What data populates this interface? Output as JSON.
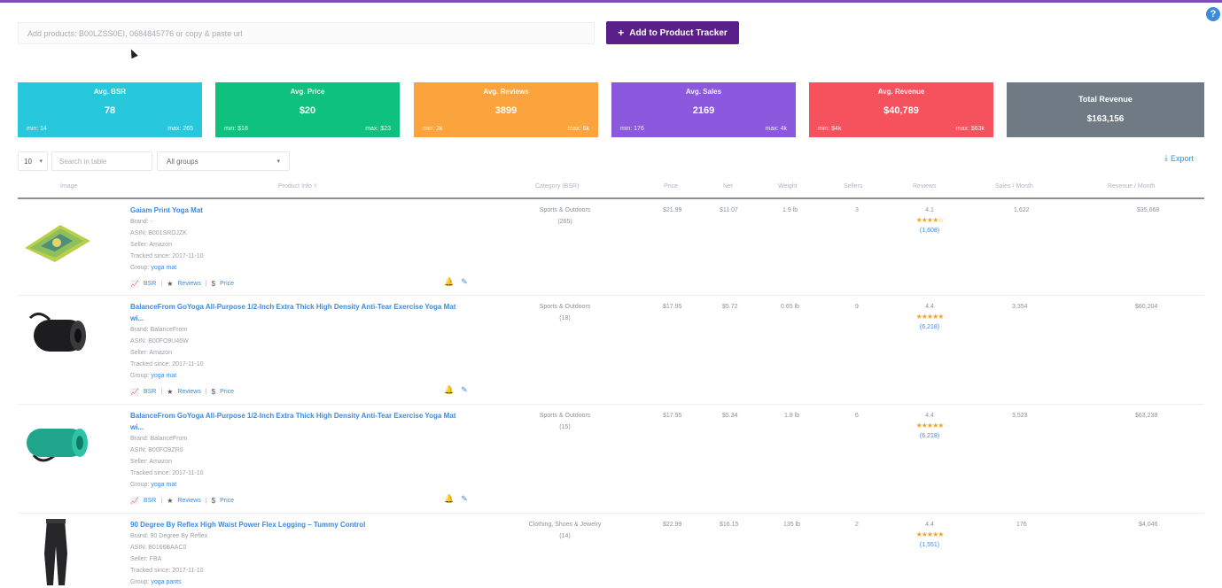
{
  "help": {
    "label": "?"
  },
  "add": {
    "placeholder": "Add products: B00LZSS0EI, 0684845776 or copy & paste url",
    "button_label": "Add to Product Tracker"
  },
  "stats": [
    {
      "label": "Avg. BSR",
      "value": "78",
      "min": "min: 14",
      "max": "max: 265",
      "color": "#27c8db"
    },
    {
      "label": "Avg. Price",
      "value": "$20",
      "min": "min: $18",
      "max": "max: $23",
      "color": "#0ec17e"
    },
    {
      "label": "Avg. Reviews",
      "value": "3899",
      "min": "min: 2k",
      "max": "max: 6k",
      "color": "#fba33c"
    },
    {
      "label": "Avg. Sales",
      "value": "2169",
      "min": "min: 176",
      "max": "max: 4k",
      "color": "#8c58de"
    },
    {
      "label": "Avg. Revenue",
      "value": "$40,789",
      "min": "min: $4k",
      "max": "max: $63k",
      "color": "#f5525e"
    }
  ],
  "total_revenue": {
    "label": "Total Revenue",
    "value": "$163,156",
    "color": "#6f7a84"
  },
  "table_controls": {
    "page_size": "10",
    "search_placeholder": "Search in table",
    "group": "All groups",
    "export": "Export"
  },
  "columns": {
    "image": "Image",
    "product": "Product Info",
    "category": "Category (BSR)",
    "price": "Price",
    "net": "Net",
    "weight": "Weight",
    "sellers": "Sellers",
    "reviews": "Reviews",
    "sales": "Sales / Month",
    "revenue": "Revenue / Month"
  },
  "rows": [
    {
      "title": "Gaiam Print Yoga Mat",
      "brand": "Brand: -",
      "asin": "ASIN: B001SRDJZK",
      "seller": "Seller: Amazon",
      "tracked": "Tracked since: 2017-11-10",
      "group_label": "Group:",
      "group": "yoga mat",
      "bsr": "BSR",
      "reviews_link": "Reviews",
      "price_link": "Price",
      "category": "Sports & Outdoors",
      "rank": "(265)",
      "price": "$21.99",
      "net": "$11.07",
      "weight": "1.9 lb",
      "sellers": "3",
      "rating": "4.1",
      "stars": "★★★★☆",
      "review_count": "(1,608)",
      "sales": "1,622",
      "revenue": "$35,668"
    },
    {
      "title": "BalanceFrom GoYoga All-Purpose 1/2-Inch Extra Thick High Density Anti-Tear Exercise Yoga Mat",
      "title2": "wi...",
      "brand": "Brand: BalanceFrom",
      "asin": "ASIN: B00FO9U46W",
      "seller": "Seller: Amazon",
      "tracked": "Tracked since: 2017-11-10",
      "group_label": "Group:",
      "group": "yoga mat",
      "bsr": "BSR",
      "reviews_link": "Reviews",
      "price_link": "Price",
      "category": "Sports & Outdoors",
      "rank": "(18)",
      "price": "$17.95",
      "net": "$5.72",
      "weight": "0.65 lb",
      "sellers": "9",
      "rating": "4.4",
      "stars": "★★★★★",
      "review_count": "(6,218)",
      "sales": "3,354",
      "revenue": "$60,204"
    },
    {
      "title": "BalanceFrom GoYoga All-Purpose 1/2-Inch Extra Thick High Density Anti-Tear Exercise Yoga Mat",
      "title2": "wi...",
      "brand": "Brand: BalanceFrom",
      "asin": "ASIN: B00FO9ZR0",
      "seller": "Seller: Amazon",
      "tracked": "Tracked since: 2017-11-10",
      "group_label": "Group:",
      "group": "yoga mat",
      "bsr": "BSR",
      "reviews_link": "Reviews",
      "price_link": "Price",
      "category": "Sports & Outdoors",
      "rank": "(15)",
      "price": "$17.95",
      "net": "$5.34",
      "weight": "1.8 lb",
      "sellers": "6",
      "rating": "4.4",
      "stars": "★★★★★",
      "review_count": "(6,218)",
      "sales": "3,523",
      "revenue": "$63,238"
    },
    {
      "title": "90 Degree By Reflex High Waist Power Flex Legging – Tummy Control",
      "brand": "Brand: 90 Degree By Reflex",
      "asin": "ASIN: B0166BAAC0",
      "seller": "Seller: FBA",
      "tracked": "Tracked since: 2017-11-10",
      "group_label": "Group:",
      "group": "yoga pants",
      "category": "Clothing, Shoes & Jewelry",
      "rank": "(14)",
      "price": "$22.99",
      "net": "$16.15",
      "weight": "135 lb",
      "sellers": "2",
      "rating": "4.4",
      "stars": "★★★★★",
      "review_count": "(1,551)",
      "sales": "176",
      "revenue": "$4,046"
    }
  ]
}
